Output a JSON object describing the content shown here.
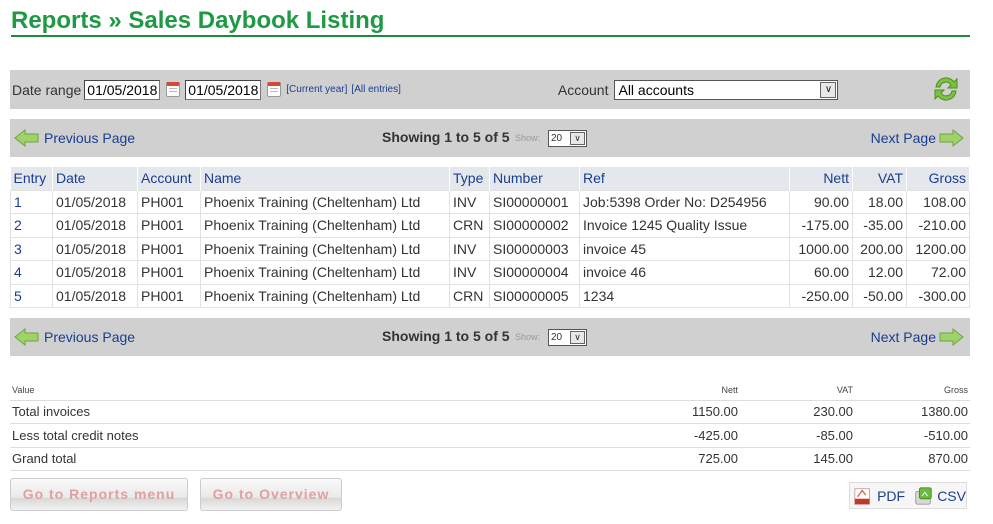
{
  "page": {
    "title": "Reports » Sales Daybook Listing"
  },
  "filters": {
    "date_range_label": "Date range",
    "date_from": "01/05/2018",
    "date_to": "01/05/2018",
    "current_year_link": "[Current year]",
    "all_entries_link": "[All entries]",
    "account_label": "Account",
    "account_selected": "All accounts",
    "refresh_icon": "refresh-icon"
  },
  "pager": {
    "previous_label": "Previous Page",
    "next_label": "Next Page",
    "showing_text": "Showing 1 to 5 of 5",
    "show_label": "Show:",
    "show_value": "20"
  },
  "table": {
    "columns": [
      "Entry",
      "Date",
      "Account",
      "Name",
      "Type",
      "Number",
      "Ref",
      "Nett",
      "VAT",
      "Gross"
    ],
    "rows": [
      {
        "entry": "1",
        "date": "01/05/2018",
        "account": "PH001",
        "name": "Phoenix Training (Cheltenham) Ltd",
        "type": "INV",
        "number": "SI00000001",
        "ref": "Job:5398 Order No: D254956",
        "nett": "90.00",
        "vat": "18.00",
        "gross": "108.00"
      },
      {
        "entry": "2",
        "date": "01/05/2018",
        "account": "PH001",
        "name": "Phoenix Training (Cheltenham) Ltd",
        "type": "CRN",
        "number": "SI00000002",
        "ref": "Invoice 1245 Quality Issue",
        "nett": "-175.00",
        "vat": "-35.00",
        "gross": "-210.00"
      },
      {
        "entry": "3",
        "date": "01/05/2018",
        "account": "PH001",
        "name": "Phoenix Training (Cheltenham) Ltd",
        "type": "INV",
        "number": "SI00000003",
        "ref": "invoice 45",
        "nett": "1000.00",
        "vat": "200.00",
        "gross": "1200.00"
      },
      {
        "entry": "4",
        "date": "01/05/2018",
        "account": "PH001",
        "name": "Phoenix Training (Cheltenham) Ltd",
        "type": "INV",
        "number": "SI00000004",
        "ref": "invoice 46",
        "nett": "60.00",
        "vat": "12.00",
        "gross": "72.00"
      },
      {
        "entry": "5",
        "date": "01/05/2018",
        "account": "PH001",
        "name": "Phoenix Training (Cheltenham) Ltd",
        "type": "CRN",
        "number": "SI00000005",
        "ref": "1234",
        "nett": "-250.00",
        "vat": "-50.00",
        "gross": "-300.00"
      }
    ]
  },
  "totals": {
    "columns": [
      "Value",
      "Nett",
      "VAT",
      "Gross"
    ],
    "rows": [
      {
        "label": "Total invoices",
        "nett": "1150.00",
        "vat": "230.00",
        "gross": "1380.00"
      },
      {
        "label": "Less total credit notes",
        "nett": "-425.00",
        "vat": "-85.00",
        "gross": "-510.00"
      },
      {
        "label": "Grand total",
        "nett": "725.00",
        "vat": "145.00",
        "gross": "870.00"
      }
    ]
  },
  "actions": {
    "reports_menu": "Go to Reports menu",
    "overview": "Go to Overview",
    "pdf": "PDF",
    "csv": "CSV"
  },
  "colors": {
    "title_green": "#1e9a44",
    "link_blue": "#1a3e8f",
    "bar_gray": "#d0d0d0"
  }
}
